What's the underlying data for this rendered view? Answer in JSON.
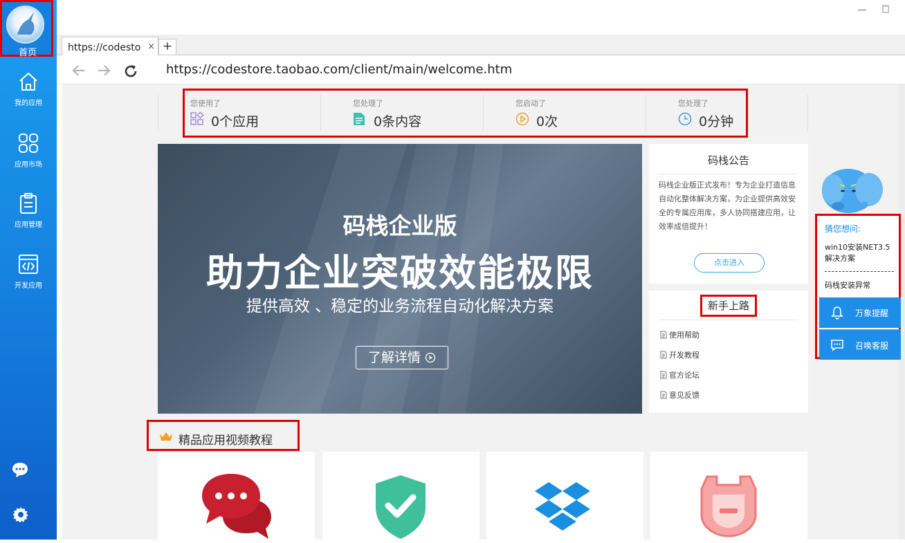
{
  "sidebar": {
    "home_label": "首页",
    "items": [
      {
        "label": "我的应用",
        "icon": "home-icon"
      },
      {
        "label": "应用市场",
        "icon": "grid-icon"
      },
      {
        "label": "应用管理",
        "icon": "clipboard-icon"
      },
      {
        "label": "开发应用",
        "icon": "code-window-icon"
      }
    ],
    "bottom_icons": [
      "chat-icon",
      "gear-icon"
    ]
  },
  "browser": {
    "tab_title": "https://codesto",
    "tab_close": "×",
    "new_tab": "+",
    "url": "https://codestore.taobao.com/client/main/welcome.htm"
  },
  "stats": [
    {
      "title": "您使用了",
      "value": "0个应用",
      "icon": "apps-icon"
    },
    {
      "title": "您处理了",
      "value": "0条内容",
      "icon": "document-icon"
    },
    {
      "title": "您启动了",
      "value": "0次",
      "icon": "play-icon"
    },
    {
      "title": "您处理了",
      "value": "0分钟",
      "icon": "clock-icon"
    }
  ],
  "banner": {
    "title": "码栈企业版",
    "headline": "助力企业突破效能极限",
    "subtitle": "提供高效 、稳定的业务流程自动化解决方案",
    "button": "了解详情"
  },
  "notice": {
    "title": "码栈公告",
    "body": "码栈企业版正式发布！专为企业打造信息自动化整体解决方案，为企业提供高效安全的专属应用库，多人协同搭建应用，让效率成倍提升！",
    "enter_button": "点击进入"
  },
  "guide": {
    "title": "新手上路",
    "items": [
      "使用帮助",
      "开发教程",
      "官方论坛",
      "意见反馈"
    ]
  },
  "assistant": {
    "prompt": "猜您想问:",
    "question1": "win10安装NET3.5解决方案",
    "question2": "码栈安装异常",
    "remind_button": "万象提醒",
    "service_button": "召唤客服"
  },
  "tutorials": {
    "title": "精品应用视频教程",
    "cards": [
      {
        "icon": "chat-bubbles-icon",
        "color": "#c8202f"
      },
      {
        "icon": "shield-check-icon",
        "color": "#3fbf9c"
      },
      {
        "icon": "dropbox-icon",
        "color": "#1a8fe0"
      },
      {
        "icon": "robot-icon",
        "color": "#f08a88"
      }
    ]
  }
}
